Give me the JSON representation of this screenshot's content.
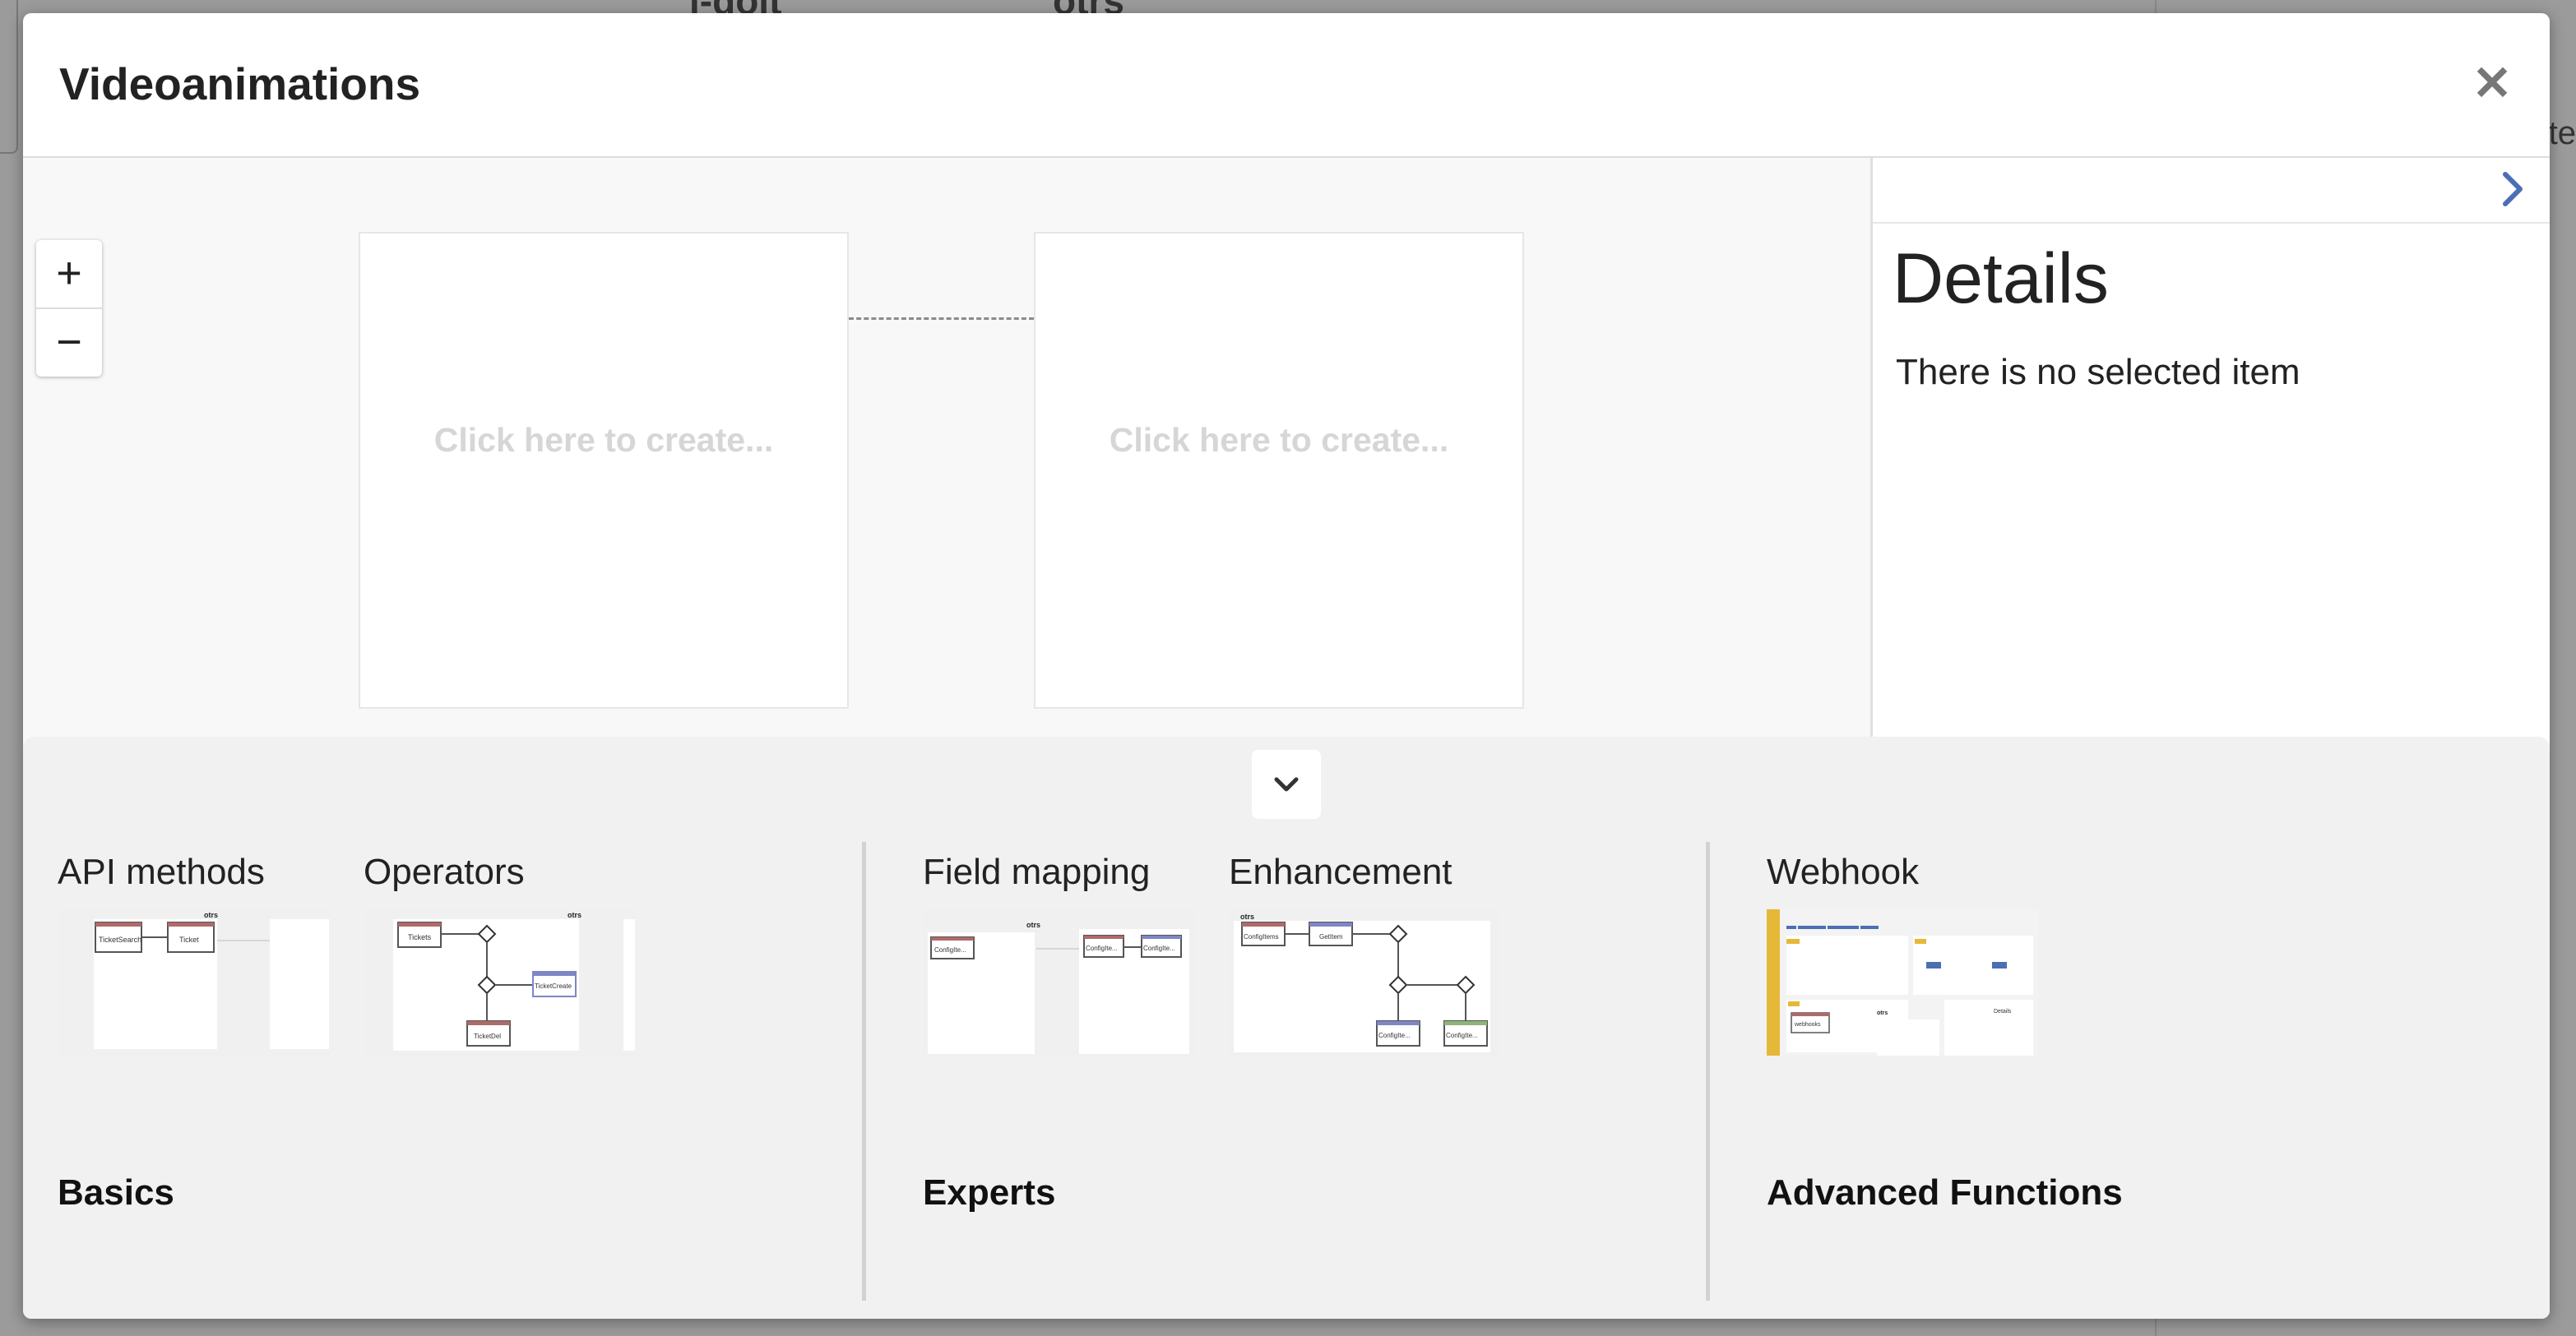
{
  "background": {
    "partial_text_1": "i-doit",
    "partial_text_2": "otrs",
    "partial_text_right": "ate"
  },
  "modal": {
    "title": "Videoanimations",
    "close_icon": "close-icon"
  },
  "canvas": {
    "zoom_in": "+",
    "zoom_out": "−",
    "node_placeholder_left": "Click here to create...",
    "node_placeholder_right": "Click here to create..."
  },
  "details": {
    "title": "Details",
    "empty_text": "There is no selected item",
    "toggle_icon": "chevron-right-icon"
  },
  "tutorials": {
    "collapse_icon": "chevron-down-icon",
    "groups": [
      {
        "title": "Basics",
        "items": [
          {
            "label": "API methods",
            "thumb_nodes": [
              "TicketSearch",
              "Ticket"
            ],
            "thumb_header": "otrs"
          },
          {
            "label": "Operators",
            "thumb_nodes": [
              "Tickets",
              "TicketCreate",
              "TicketDel"
            ],
            "thumb_header": "otrs"
          }
        ]
      },
      {
        "title": "Experts",
        "items": [
          {
            "label": "Field mapping",
            "thumb_nodes": [
              "ConfigIte...",
              "ConfigIte...",
              "ConfigIte..."
            ],
            "thumb_header": "otrs"
          },
          {
            "label": "Enhancement",
            "thumb_nodes": [
              "ConfigItems",
              "GetItem",
              "ConfigIte...",
              "ConfigIte..."
            ],
            "thumb_header": "otrs"
          }
        ]
      },
      {
        "title": "Advanced Functions",
        "items": [
          {
            "label": "Webhook",
            "thumb_nodes": [
              "webhooks",
              "Details"
            ],
            "thumb_header": "otrs"
          }
        ]
      }
    ]
  },
  "colors": {
    "accent": "#4a6fb5",
    "placeholder_text": "#d6d6d6",
    "panel_bg": "#f1f1f1",
    "node_header_red": "#b06a6a",
    "node_header_blue": "#7e86c7",
    "webhook_sidebar": "#e6b838"
  }
}
